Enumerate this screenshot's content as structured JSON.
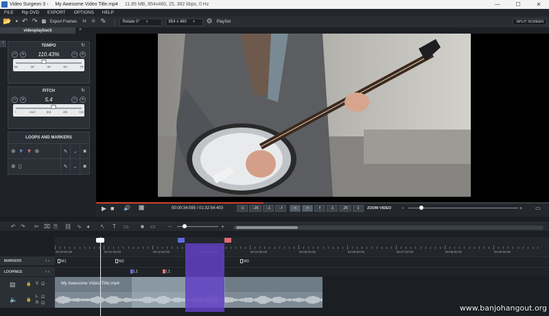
{
  "window": {
    "app_title": "Video Surgeon 3 -",
    "file_title": "My Awesome Video Title.mp4",
    "file_meta": "11.85 MB, 854x480, 25, 382 kbps, 0 Hz"
  },
  "menu": [
    "FILE",
    "Rip DVD",
    "EXPORT",
    "OPTIONS",
    "HELP"
  ],
  "toolbar": {
    "export_frames": "Export Frames",
    "rotate": "Rotate 0°",
    "resolution": "854 x 480",
    "playlist": "PlaySet",
    "split_screen": "SPLIT SCREEN"
  },
  "tab": {
    "name": "videoplayback"
  },
  "tempo": {
    "title": "TEMPO",
    "value": "110.43%",
    "ticks": [
      "25",
      "30",
      "40",
      "50",
      "75"
    ],
    "level": 0.42
  },
  "pitch": {
    "title": "PITCH",
    "value": "5.4",
    "ticks": [
      "+",
      "2nd",
      "3rd",
      "4th",
      "Oct"
    ],
    "level": 0.56
  },
  "loops": {
    "title": "LOOPS AND MARKERS"
  },
  "player": {
    "timecode": "00:00:34:095 / 01:32:54:403",
    "steps": [
      "-1",
      "-.25",
      "-.1",
      "-.f",
      "<",
      ">",
      "f",
      ".1",
      ".25",
      "1"
    ],
    "zoom_label": "ZOOM VIDEO",
    "progress": 0.37,
    "zoom_level": 0.1
  },
  "ruler": {
    "labels": [
      "00:00:00:00",
      "00:01:00:00",
      "00:02:00:00",
      "00:03:00:00",
      "00:04:00:00",
      "00:05:00:00",
      "00:06:00:00",
      "00:07:00:00",
      "00:08:00:00",
      "00:09:00:00"
    ]
  },
  "lanes": {
    "markers_label": "MARKERS",
    "looping_label": "LOOPINGS"
  },
  "markers": [
    {
      "name": "M1"
    },
    {
      "name": "M2"
    },
    {
      "name": "M3"
    }
  ],
  "loop_markers": [
    {
      "name": "L1",
      "color": "#6b6bd6"
    },
    {
      "name": "L1",
      "color": "#e57373"
    }
  ],
  "clip": {
    "title": "My Awesome Video Title.mp4"
  },
  "watermark": "www.banjohangout.org",
  "colors": {
    "accent": "#d1422e",
    "selection": "#6240c4"
  }
}
